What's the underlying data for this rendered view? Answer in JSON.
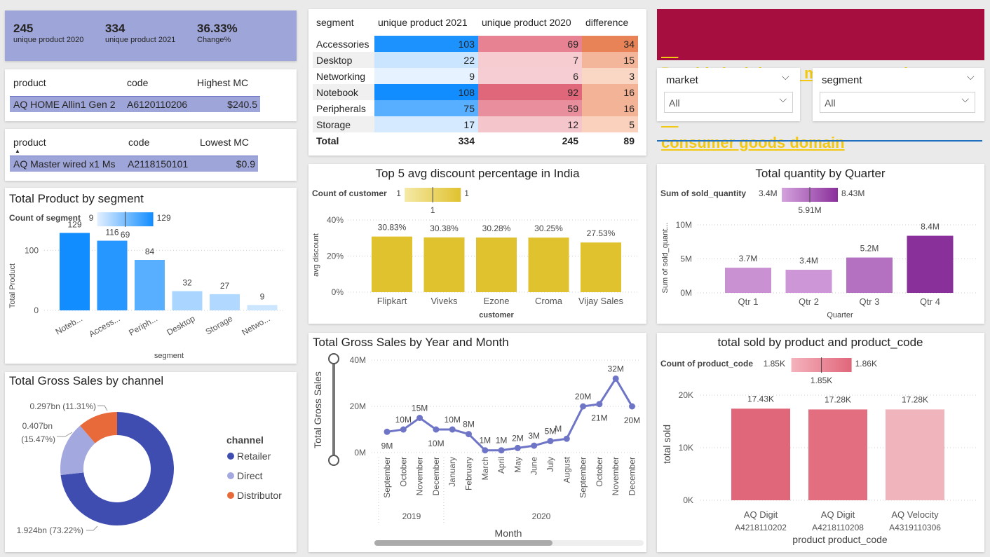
{
  "kpi": {
    "items": [
      {
        "value": "245",
        "label": "unique product 2020"
      },
      {
        "value": "334",
        "label": "unique product 2021"
      },
      {
        "value": "36.33%",
        "label": "Change%"
      }
    ]
  },
  "highest": {
    "headers": [
      "product",
      "code",
      "Highest MC"
    ],
    "row": [
      "AQ HOME Allin1 Gen 2",
      "A6120110206",
      "$240.5"
    ]
  },
  "lowest": {
    "headers": [
      "product",
      "code",
      "Lowest MC"
    ],
    "row": [
      "AQ Master wired x1 Ms",
      "A2118150101",
      "$0.9"
    ]
  },
  "segment_table": {
    "headers": [
      "segment",
      "unique product 2021",
      "unique product 2020",
      "difference"
    ],
    "rows": [
      [
        "Accessories",
        "103",
        "69",
        "34"
      ],
      [
        "Desktop",
        "22",
        "7",
        "15"
      ],
      [
        "Networking",
        "9",
        "6",
        "3"
      ],
      [
        "Notebook",
        "108",
        "92",
        "16"
      ],
      [
        "Peripherals",
        "75",
        "59",
        "16"
      ],
      [
        "Storage",
        "17",
        "12",
        "5"
      ]
    ],
    "total": [
      "Total",
      "334",
      "245",
      "89"
    ]
  },
  "banner": {
    "title_line1": "Provide insights to management in ",
    "title_line2": "consumer goods domain"
  },
  "slicers": {
    "market": {
      "label": "market",
      "value": "All"
    },
    "segment": {
      "label": "segment",
      "value": "All"
    }
  },
  "colors": {
    "accent_blue": "#118dff",
    "banner": "#a50e3f",
    "banner_text": "#f2c811",
    "kpi_bg": "#9ea5d8",
    "row_highlight": "#9ea5d8",
    "gold": "#e0c22f",
    "purple": "#8a2f9b",
    "red": "#e0667a",
    "navy": "#3f4db1",
    "line": "#6f75c6",
    "orange": "#e8693a"
  },
  "chart_segment": {
    "title": "Total Product by segment",
    "legend": {
      "title": "Count of segment",
      "min": "9",
      "max": "129",
      "marker": "69"
    },
    "ylabel": "Total Product",
    "xlabel": "segment",
    "yticks": [
      "0",
      "100"
    ],
    "chart_data": {
      "type": "bar",
      "categories": [
        "Noteb...",
        "Access...",
        "Periph...",
        "Desktop",
        "Storage",
        "Netwo..."
      ],
      "values": [
        129,
        116,
        84,
        32,
        27,
        9
      ],
      "labels": [
        "129",
        "116",
        "84",
        "32",
        "27",
        "9"
      ],
      "ylim": [
        0,
        140
      ]
    }
  },
  "chart_channel": {
    "title": "Total Gross Sales by channel",
    "legend": {
      "title": "channel",
      "items": [
        "Retailer",
        "Direct",
        "Distributor"
      ]
    },
    "chart_data": {
      "type": "pie",
      "categories": [
        "Retailer",
        "Direct",
        "Distributor"
      ],
      "values": [
        73.22,
        15.47,
        11.31
      ],
      "labels": [
        "1.924bn (73.22%)",
        "0.407bn",
        "(15.47%)",
        "0.297bn (11.31%)"
      ]
    }
  },
  "chart_discount": {
    "title": "Top 5 avg discount percentage in India",
    "legend": {
      "title": "Count of customer",
      "min": "1",
      "max": "1",
      "marker": "1"
    },
    "ylabel": "avg discount",
    "xlabel": "customer",
    "yticks": [
      "0%",
      "20%",
      "40%"
    ],
    "chart_data": {
      "type": "bar",
      "categories": [
        "Flipkart",
        "Viveks",
        "Ezone",
        "Croma",
        "Vijay Sales"
      ],
      "values": [
        30.83,
        30.38,
        30.28,
        30.25,
        27.53
      ],
      "labels": [
        "30.83%",
        "30.38%",
        "30.28%",
        "30.25%",
        "27.53%"
      ],
      "ylim": [
        0,
        40
      ]
    }
  },
  "chart_quarter": {
    "title": "Total quantity by Quarter",
    "legend": {
      "title": "Sum of sold_quantity",
      "min": "3.4M",
      "max": "8.43M",
      "marker": "5.91M"
    },
    "ylabel": "Sum of sold_quant...",
    "xlabel": "Quarter",
    "yticks": [
      "0M",
      "5M",
      "10M"
    ],
    "chart_data": {
      "type": "bar",
      "categories": [
        "Qtr 1",
        "Qtr 2",
        "Qtr 3",
        "Qtr 4"
      ],
      "values": [
        3.7,
        3.4,
        5.2,
        8.4
      ],
      "labels": [
        "3.7M",
        "3.4M",
        "5.2M",
        "8.4M"
      ],
      "ylim": [
        0,
        10
      ]
    }
  },
  "chart_gross": {
    "title": "Total Gross Sales by Year and Month",
    "ylabel": "Total Gross Sales",
    "xlabel": "Month",
    "yticks": [
      "0M",
      "20M",
      "40M"
    ],
    "years": [
      "2019",
      "2020"
    ],
    "chart_data": {
      "type": "line",
      "x": [
        "September",
        "October",
        "November",
        "December",
        "January",
        "February",
        "March",
        "April",
        "May",
        "June",
        "July",
        "August",
        "September",
        "October",
        "November",
        "December"
      ],
      "values": [
        9,
        10,
        15,
        10,
        10,
        8,
        1,
        1,
        2,
        3,
        5,
        6,
        20,
        21,
        32,
        20
      ],
      "labels": [
        "9M",
        "10M",
        "15M",
        "10M",
        "10M",
        "8M",
        "1M",
        "1M",
        "2M",
        "3M",
        "5M",
        "M",
        "20M",
        "21M",
        "32M",
        "20M"
      ],
      "ylim": [
        0,
        40
      ]
    }
  },
  "chart_product": {
    "title": "total sold by product and product_code",
    "legend": {
      "title": "Count of product_code",
      "min": "1.85K",
      "max": "1.86K",
      "marker": "1.85K"
    },
    "ylabel": "total sold",
    "xlabel": "product product_code",
    "yticks": [
      "0K",
      "10K",
      "20K"
    ],
    "chart_data": {
      "type": "bar",
      "categories": [
        "AQ Digit",
        "AQ Digit",
        "AQ Velocity"
      ],
      "codes": [
        "A4218110202",
        "A4218110208",
        "A4319110306"
      ],
      "values": [
        17.43,
        17.28,
        17.28
      ],
      "labels": [
        "17.43K",
        "17.28K",
        "17.28K"
      ],
      "ylim": [
        0,
        20
      ]
    }
  }
}
